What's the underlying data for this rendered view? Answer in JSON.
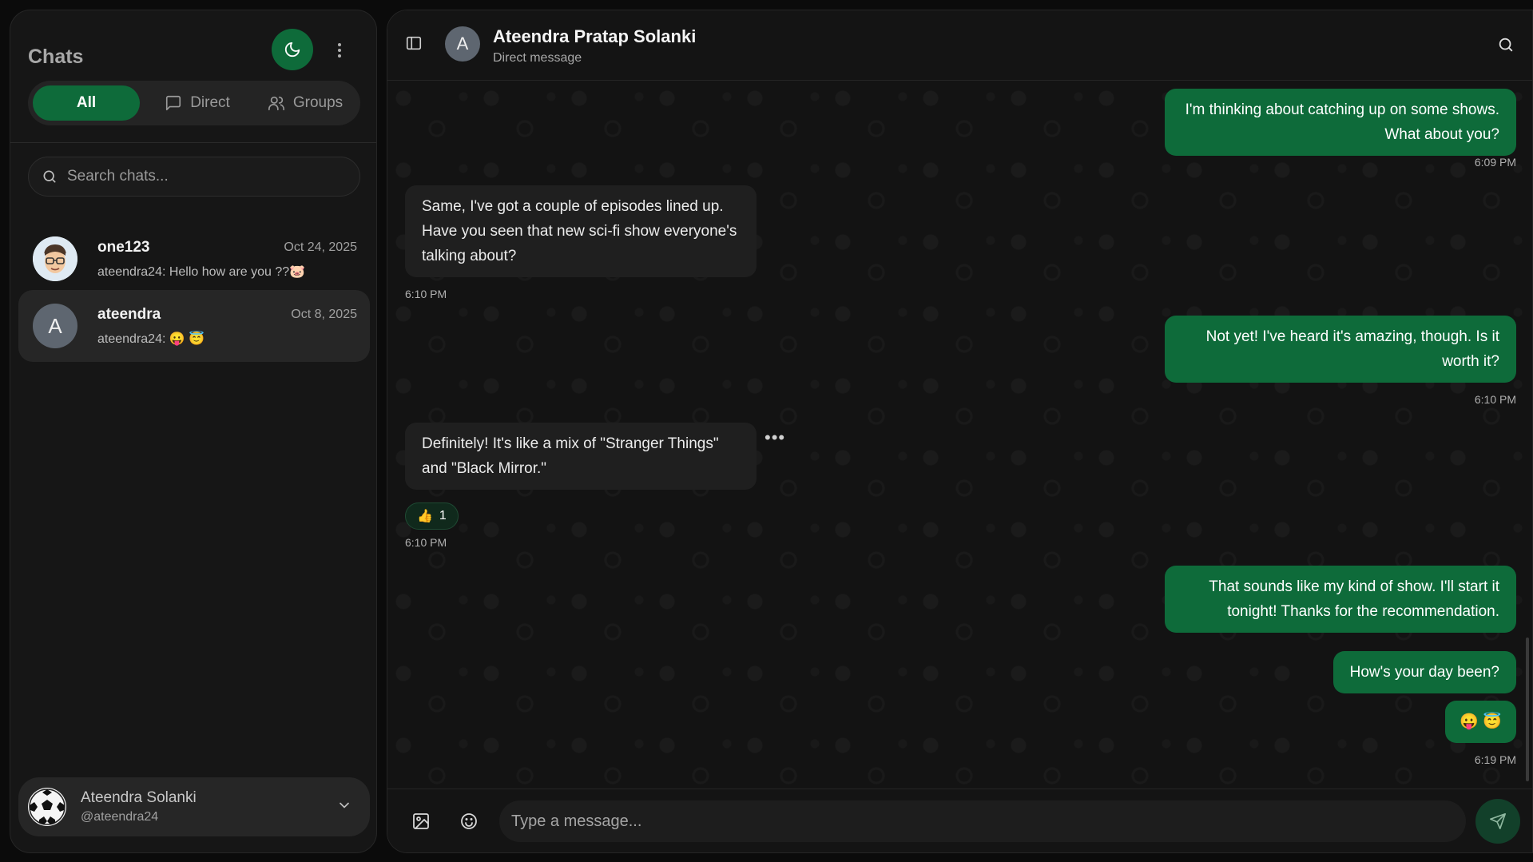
{
  "sidebar": {
    "title": "Chats",
    "tabs": [
      {
        "label": "All"
      },
      {
        "label": "Direct"
      },
      {
        "label": "Groups"
      }
    ],
    "search": {
      "placeholder": "Search chats..."
    },
    "chats": [
      {
        "name": "one123",
        "date": "Oct 24, 2025",
        "preview": "ateendra24: Hello how are you ??🐷"
      },
      {
        "name": "ateendra",
        "date": "Oct 8, 2025",
        "preview": "ateendra24: 😛 😇",
        "avatar_letter": "A"
      }
    ],
    "profile": {
      "name": "Ateendra Solanki",
      "handle": "@ateendra24"
    }
  },
  "header": {
    "avatar_letter": "A",
    "name": "Ateendra Pratap Solanki",
    "subtitle": "Direct message"
  },
  "messages": [
    {
      "dir": "out",
      "text": "I'm thinking about catching up on some shows. What about you?",
      "time": "6:09 PM"
    },
    {
      "dir": "in",
      "text": "Same, I've got a couple of episodes lined up. Have you seen that new sci-fi show everyone's talking about?",
      "time": "6:10 PM"
    },
    {
      "dir": "out",
      "text": "Not yet! I've heard it's amazing, though. Is it worth it?",
      "time": "6:10 PM"
    },
    {
      "dir": "in",
      "text": "Definitely! It's like a mix of \"Stranger Things\" and \"Black Mirror.\"",
      "time": "6:10 PM",
      "reaction": {
        "emoji": "👍",
        "count": "1"
      }
    },
    {
      "dir": "out",
      "text": "That sounds like my kind of show. I'll start it tonight! Thanks for the recommendation.",
      "time": ""
    },
    {
      "dir": "out",
      "text": "How's your day been?",
      "time": ""
    },
    {
      "dir": "out",
      "text": "😛 😇",
      "time": "6:19 PM"
    }
  ],
  "composer": {
    "placeholder": "Type a message..."
  },
  "colors": {
    "accent": "#0e6b3a",
    "background": "#121212",
    "incoming_bubble": "#1f1f1f"
  }
}
